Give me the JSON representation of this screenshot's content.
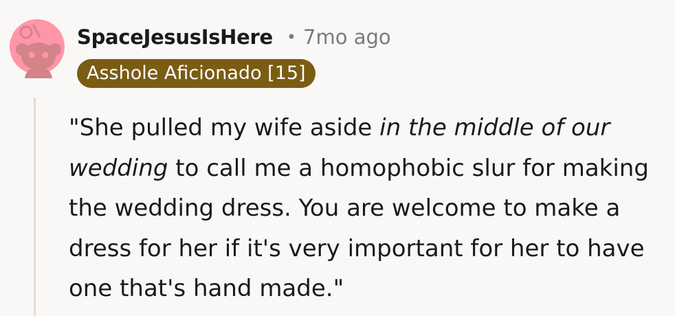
{
  "comment": {
    "author": "SpaceJesusIsHere",
    "separator": "•",
    "timestamp": "7mo ago",
    "flair": "Asshole Aficionado [15]",
    "avatar_icon": "reddit-snoo-avatar-icon",
    "colors": {
      "avatar_bg": "#ff96a8",
      "flair_bg": "#7a5c12",
      "thread_line": "#e6dbd4"
    },
    "body": {
      "segment1": "\"She pulled my wife aside ",
      "segment2_italic": "in the middle of our wedding",
      "segment3": " to call me a homophobic slur for making the wedding dress. You are welcome to make a dress for her if it's very important for her to have one that's hand made.\""
    }
  }
}
